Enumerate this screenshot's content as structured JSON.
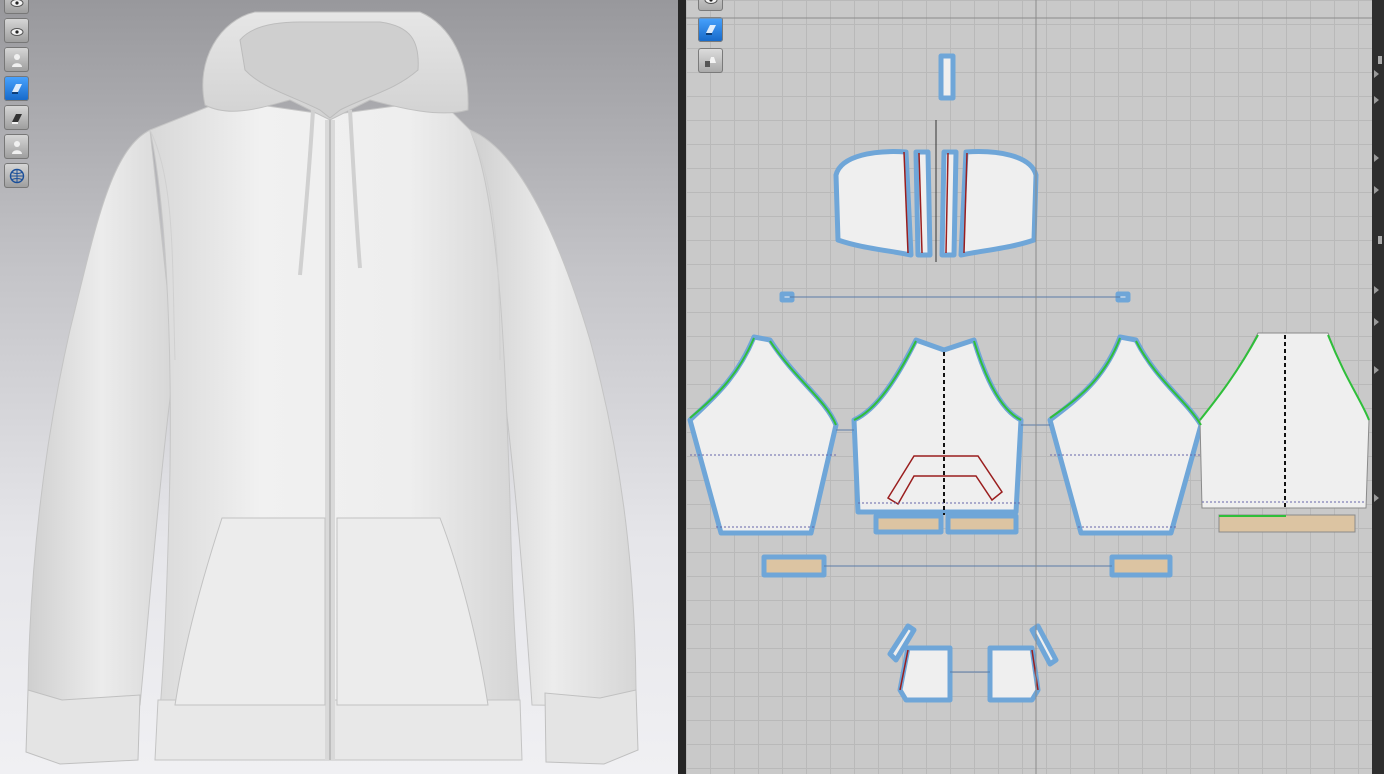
{
  "app": {
    "viewports": [
      "3d-garment",
      "2d-pattern"
    ]
  },
  "toolbar_3d": {
    "tools": [
      {
        "icon": "show-avatar-icon"
      },
      {
        "icon": "show-garment-icon"
      },
      {
        "icon": "show-avatar-body-icon"
      },
      {
        "icon": "texture-display-icon",
        "active": true
      },
      {
        "icon": "thickness-display-icon"
      },
      {
        "icon": "avatar-silhouette-icon"
      },
      {
        "icon": "mesh-display-icon"
      }
    ]
  },
  "toolbar_2d": {
    "tools": [
      {
        "icon": "show-pattern-icon"
      },
      {
        "icon": "texture-2d-icon",
        "active": true
      },
      {
        "icon": "lock-pattern-icon"
      }
    ]
  },
  "colors": {
    "bg_2d": "#c9c9c9",
    "grid": "#b9b9b9",
    "pattern_fill": "#efefef",
    "pattern_outline": "#6fa6d8",
    "seam_green": "#2fbf3a",
    "internal_red": "#9a1e1e",
    "rib_fill": "#dcc4a2",
    "garment": "#f2f2f2"
  },
  "garment_3d": {
    "type": "zip hoodie"
  }
}
